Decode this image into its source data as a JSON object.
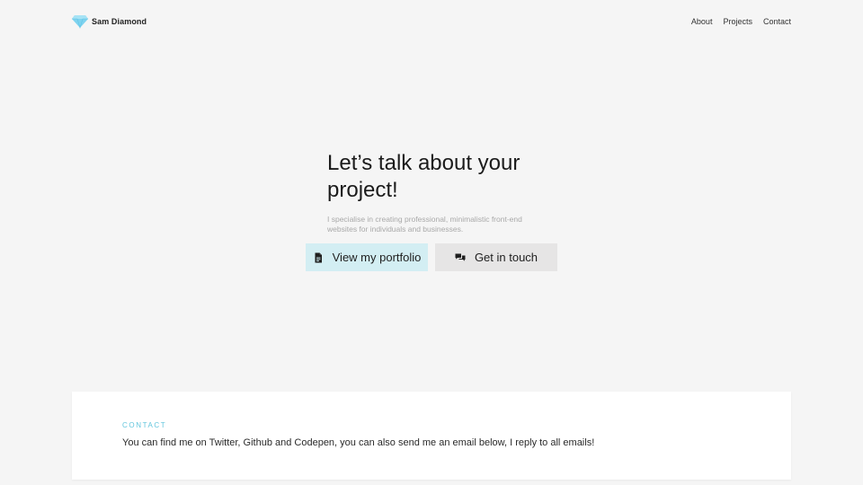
{
  "header": {
    "brand_name": "Sam Diamond",
    "nav": [
      {
        "label": "About"
      },
      {
        "label": "Projects"
      },
      {
        "label": "Contact"
      }
    ]
  },
  "hero": {
    "title": "Let’s talk about your project!",
    "subtitle": "I specialise in creating professional, minimalistic front-end websites for individuals and businesses.",
    "buttons": {
      "portfolio_label": "View my portfolio",
      "touch_label": "Get in touch"
    }
  },
  "contact": {
    "label": "CONTACT",
    "text": "You can find me on Twitter, Github and Codepen, you can also send me an email below, I reply to all emails!"
  },
  "icons": {
    "brand": "diamond-icon",
    "portfolio": "document-icon",
    "touch": "chat-bubbles-icon"
  },
  "colors": {
    "accent": "#64c6dd",
    "diamond": "#7fd3ef",
    "portfolio_button_bg": "#d3eef3",
    "touch_button_bg": "#e6e5e5",
    "page_bg": "#f5f5f5"
  }
}
